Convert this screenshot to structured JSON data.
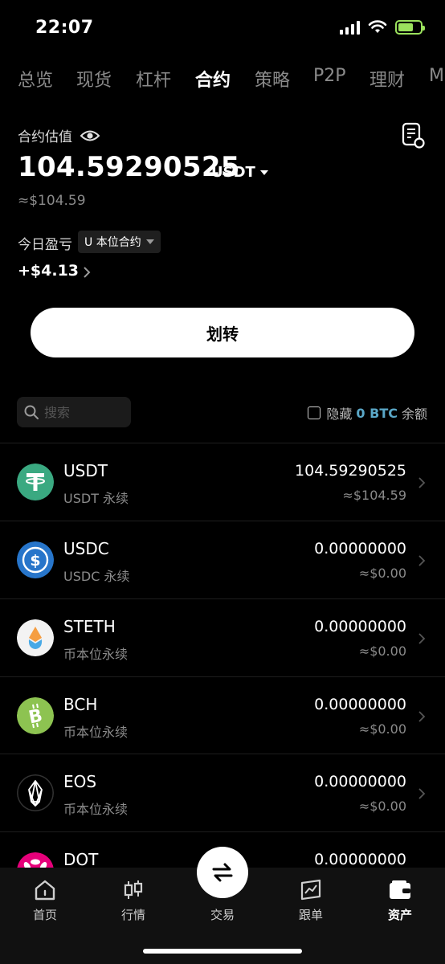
{
  "status": {
    "time": "22:07"
  },
  "tabs": [
    {
      "label": "总览"
    },
    {
      "label": "现货"
    },
    {
      "label": "杠杆"
    },
    {
      "label": "合约"
    },
    {
      "label": "策略"
    },
    {
      "label": "P2P"
    },
    {
      "label": "理财"
    },
    {
      "label": "M"
    }
  ],
  "active_tab": "合约",
  "valuation": {
    "label": "合约估值",
    "amount": "104.59290525",
    "unit": "USDT",
    "approx": "≈$104.59"
  },
  "pnl": {
    "label": "今日盈亏",
    "selector": "U 本位合约",
    "value": "+$4.13"
  },
  "transfer_label": "划转",
  "search": {
    "placeholder": "搜索"
  },
  "hide_small": {
    "prefix": "隐藏",
    "amount": "0 BTC",
    "suffix": "余额"
  },
  "assets": [
    {
      "name": "USDT",
      "sub": "USDT 永续",
      "amount": "104.59290525",
      "usd": "≈$104.59",
      "icon": "tether-icon",
      "color": "#3aa981"
    },
    {
      "name": "USDC",
      "sub": "USDC 永续",
      "amount": "0.00000000",
      "usd": "≈$0.00",
      "icon": "usdc-icon",
      "color": "#2775ca"
    },
    {
      "name": "STETH",
      "sub": "币本位永续",
      "amount": "0.00000000",
      "usd": "≈$0.00",
      "icon": "steth-icon",
      "color": "#f3f3f3"
    },
    {
      "name": "BCH",
      "sub": "币本位永续",
      "amount": "0.00000000",
      "usd": "≈$0.00",
      "icon": "bch-icon",
      "color": "#8dc351"
    },
    {
      "name": "EOS",
      "sub": "币本位永续",
      "amount": "0.00000000",
      "usd": "≈$0.00",
      "icon": "eos-icon",
      "color": "#000000"
    },
    {
      "name": "DOT",
      "sub": "",
      "amount": "0.00000000",
      "usd": "",
      "icon": "dot-icon",
      "color": "#e6007a"
    }
  ],
  "nav": {
    "home": "首页",
    "market": "行情",
    "trade": "交易",
    "copy": "跟单",
    "assets": "资产"
  }
}
